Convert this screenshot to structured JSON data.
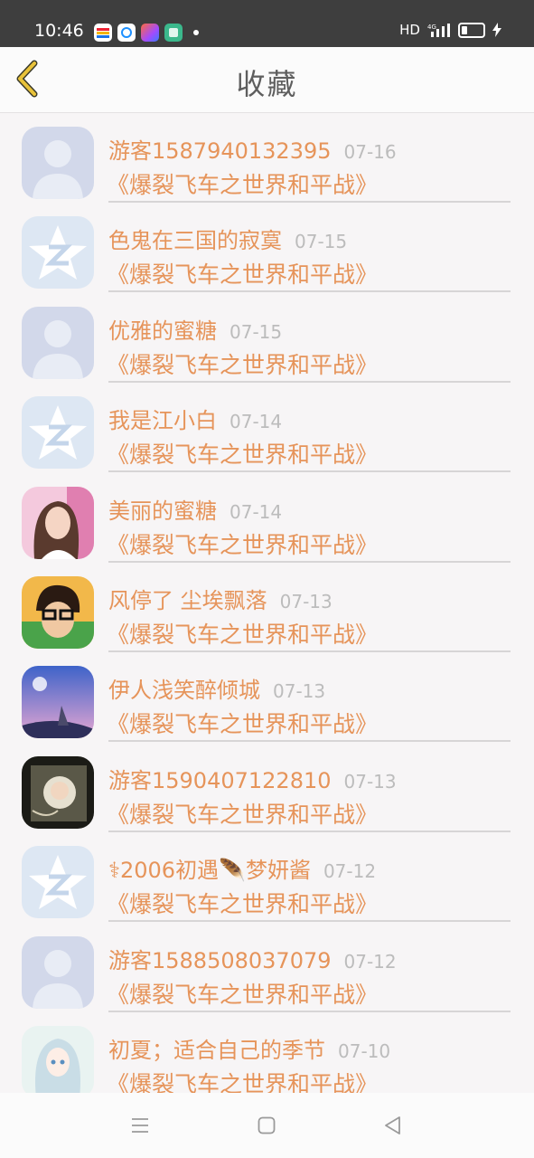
{
  "status": {
    "time": "10:46",
    "network": "HD"
  },
  "header": {
    "title": "收藏",
    "back_icon": "chevron-left-icon"
  },
  "colors": {
    "accent": "#e6945a",
    "date": "#bcbcbc",
    "back": "#e8c23a"
  },
  "items": [
    {
      "name": "游客1587940132395",
      "date": "07-16",
      "game": "《爆裂飞车之世界和平战》",
      "avatar": "default-person"
    },
    {
      "name": "色鬼在三国的寂寞",
      "date": "07-15",
      "game": "《爆裂飞车之世界和平战》",
      "avatar": "qzone-star"
    },
    {
      "name": "优雅的蜜糖",
      "date": "07-15",
      "game": "《爆裂飞车之世界和平战》",
      "avatar": "default-person"
    },
    {
      "name": "我是江小白",
      "date": "07-14",
      "game": "《爆裂飞车之世界和平战》",
      "avatar": "qzone-star"
    },
    {
      "name": "美丽的蜜糖",
      "date": "07-14",
      "game": "《爆裂飞车之世界和平战》",
      "avatar": "photo-woman"
    },
    {
      "name": "风停了 尘埃飘落",
      "date": "07-13",
      "game": "《爆裂飞车之世界和平战》",
      "avatar": "photo-boy-glasses"
    },
    {
      "name": "伊人浅笑醉倾城",
      "date": "07-13",
      "game": "《爆裂飞车之世界和平战》",
      "avatar": "photo-anime-sky"
    },
    {
      "name": "游客1590407122810",
      "date": "07-13",
      "game": "《爆裂飞车之世界和平战》",
      "avatar": "photo-dark"
    },
    {
      "name": "⚕2006初遇🪶梦妍酱",
      "date": "07-12",
      "game": "《爆裂飞车之世界和平战》",
      "avatar": "qzone-star"
    },
    {
      "name": "游客1588508037079",
      "date": "07-12",
      "game": "《爆裂飞车之世界和平战》",
      "avatar": "default-person"
    },
    {
      "name": "初夏；适合自己的季节",
      "date": "07-10",
      "game": "《爆裂飞车之世界和平战》",
      "avatar": "photo-anime-girl"
    }
  ],
  "navbar": {
    "menu_icon": "menu-icon",
    "home_icon": "home-square-icon",
    "back_icon": "back-triangle-icon"
  }
}
